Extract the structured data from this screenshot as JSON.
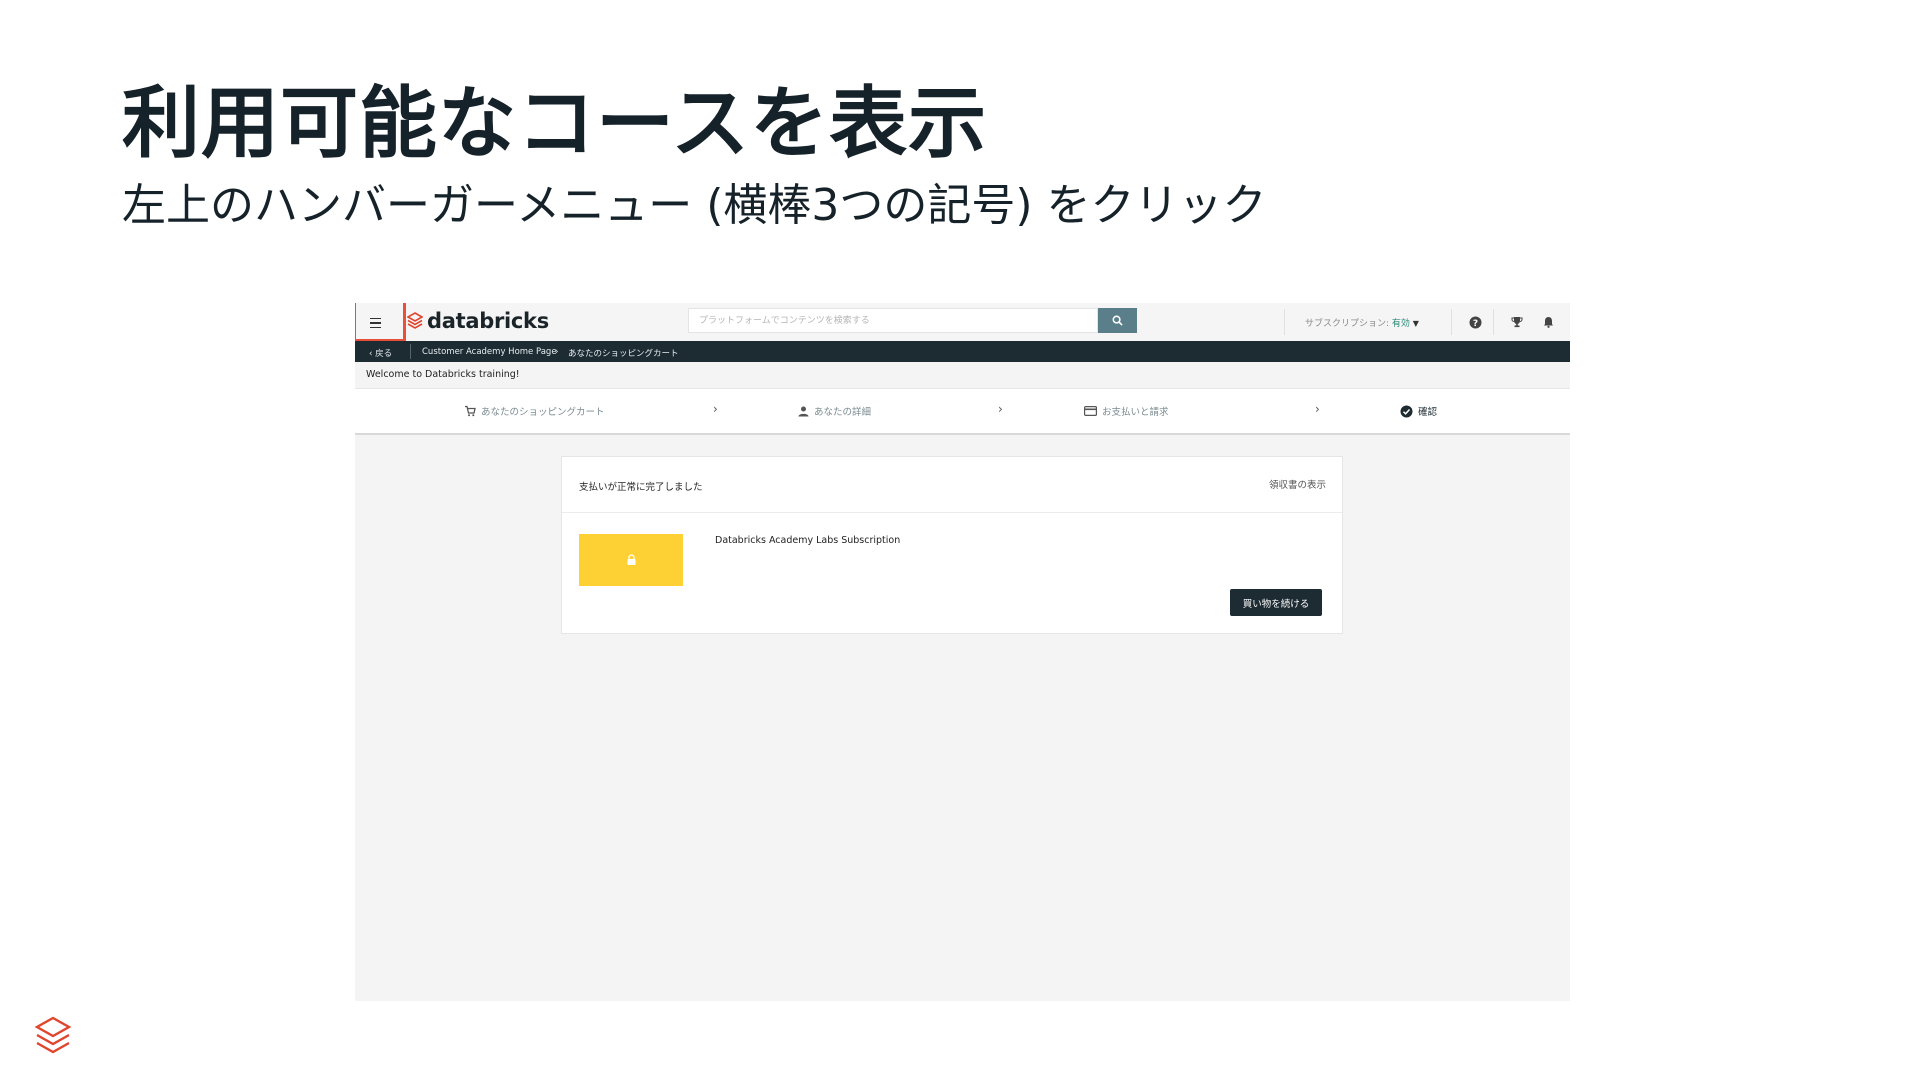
{
  "slide": {
    "title": "利用可能なコースを表示",
    "subtitle": "左上のハンバーガーメニュー (横棒3つの記号) をクリック"
  },
  "app": {
    "brand": "databricks",
    "search_placeholder": "プラットフォームでコンテンツを検索する",
    "subscription_label": "サブスクリプション: ",
    "subscription_value": "有効",
    "breadcrumb": {
      "back": "戻る",
      "items": [
        "Customer Academy Home Page",
        "あなたのショッピングカート"
      ]
    },
    "welcome": "Welcome to Databricks training!",
    "steps": [
      {
        "label": "あなたのショッピングカート",
        "icon": "cart-icon"
      },
      {
        "label": "あなたの詳細",
        "icon": "person-icon"
      },
      {
        "label": "お支払いと請求",
        "icon": "credit-card-icon"
      },
      {
        "label": "確認",
        "icon": "check-circle-icon"
      }
    ],
    "card": {
      "title": "支払いが正常に完了しました",
      "receipt_link": "領収書の表示",
      "product_name": "Databricks Academy Labs Subscription",
      "continue_button": "買い物を続ける"
    },
    "colors": {
      "accent": "#5b7f8a",
      "nav_dark": "#1d2b33",
      "highlight": "#e8503a",
      "thumbnail": "#fdd133",
      "brand_red": "#e0452e"
    }
  }
}
